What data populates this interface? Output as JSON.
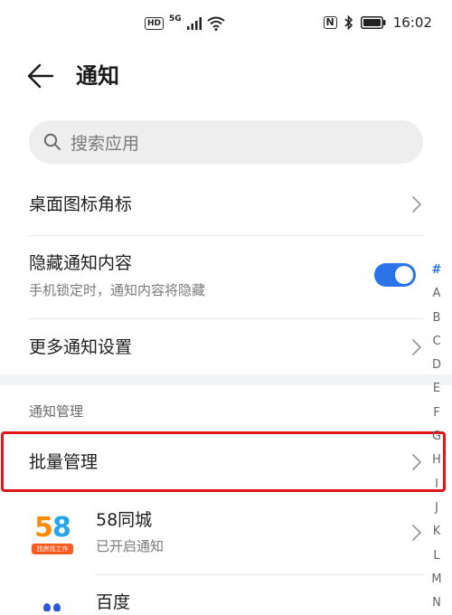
{
  "status_bar": {
    "hd_label": "HD",
    "network_label": "5G",
    "nfc_label": "N",
    "time": "16:02"
  },
  "header": {
    "title": "通知"
  },
  "search": {
    "placeholder": "搜索应用"
  },
  "settings": {
    "badge_icons_label": "桌面图标角标",
    "hide_content_label": "隐藏通知内容",
    "hide_content_sub": "手机锁定时，通知内容将隐藏",
    "hide_content_enabled": true,
    "more_settings_label": "更多通知设置"
  },
  "section": {
    "label": "通知管理"
  },
  "batch": {
    "label": "批量管理"
  },
  "apps": [
    {
      "name": "58同城",
      "status": "已开启通知",
      "icon_number": "58",
      "icon_tag": "找房找工作"
    },
    {
      "name": "百度",
      "status": ""
    }
  ],
  "alpha_index": [
    "#",
    "A",
    "B",
    "C",
    "D",
    "E",
    "F",
    "G",
    "H",
    "I",
    "J",
    "K",
    "L",
    "M",
    "N"
  ],
  "colors": {
    "accent": "#2a73e8",
    "highlight": "#e0161c"
  }
}
